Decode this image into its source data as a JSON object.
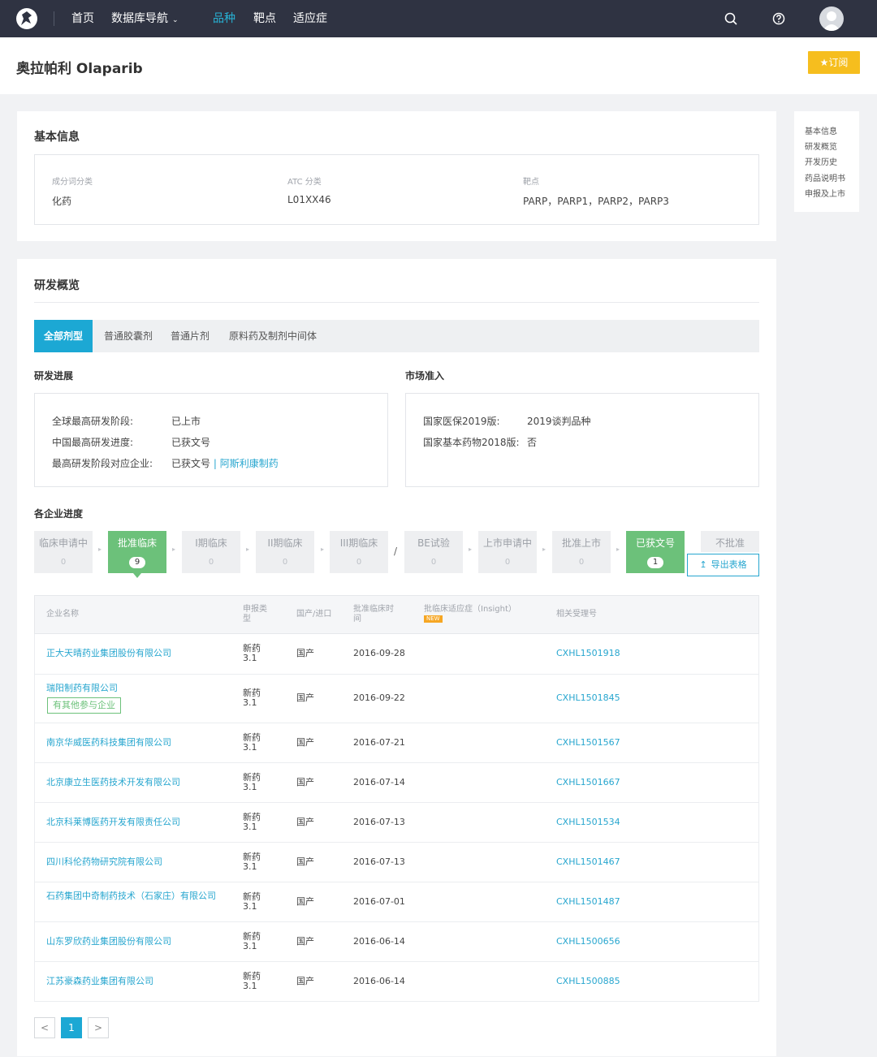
{
  "nav": {
    "home": "首页",
    "db_nav": "数据库导航",
    "variety": "品种",
    "target": "靶点",
    "indication": "适应症"
  },
  "page": {
    "title": "奥拉帕利 Olaparib",
    "subscribe": "订阅"
  },
  "basic": {
    "heading": "基本信息",
    "fields": [
      {
        "label": "成分词分类",
        "value": "化药"
      },
      {
        "label": "ATC 分类",
        "value": "L01XX46"
      },
      {
        "label": "靶点",
        "value": "PARP，PARP1，PARP2，PARP3"
      }
    ]
  },
  "rd": {
    "heading": "研发概览",
    "tabs": [
      "全部剂型",
      "普通胶囊剂",
      "普通片剂",
      "原料药及制剂中间体"
    ],
    "progress": {
      "heading": "研发进展",
      "rows": [
        {
          "k": "全球最高研发阶段:",
          "v": "已上市"
        },
        {
          "k": "中国最高研发进度:",
          "v": "已获文号"
        },
        {
          "k": "最高研发阶段对应企业:",
          "v": "已获文号",
          "sep": " | ",
          "link": "阿斯利康制药"
        }
      ]
    },
    "market": {
      "heading": "市场准入",
      "rows": [
        {
          "k": "国家医保2019版:",
          "v": "2019谈判品种"
        },
        {
          "k": "国家基本药物2018版:",
          "v": "否"
        }
      ]
    }
  },
  "enterprise": {
    "heading": "各企业进度",
    "stages": [
      {
        "name": "临床申请中",
        "count": "0"
      },
      {
        "name": "批准临床",
        "count": "9"
      },
      {
        "name": "I期临床",
        "count": "0"
      },
      {
        "name": "II期临床",
        "count": "0"
      },
      {
        "name": "III期临床",
        "count": "0"
      },
      {
        "name": "BE试验",
        "count": "0"
      },
      {
        "name": "上市申请中",
        "count": "0"
      },
      {
        "name": "批准上市",
        "count": "0"
      },
      {
        "name": "已获文号",
        "count": "1"
      },
      {
        "name": "不批准"
      }
    ],
    "slash": "/",
    "export": "导出表格",
    "columns": [
      "企业名称",
      "申报类型",
      "国产/进口",
      "批准临床时间",
      "批临床适应症（Insight）",
      "相关受理号"
    ],
    "new_badge": "NEW",
    "rows": [
      {
        "company": "正大天晴药业集团股份有限公司",
        "type": "新药 3.1",
        "origin": "国产",
        "date": "2016-09-28",
        "no": "CXHL1501918"
      },
      {
        "company": "瑞阳制药有限公司",
        "tag": "有其他参与企业",
        "type": "新药 3.1",
        "origin": "国产",
        "date": "2016-09-22",
        "no": "CXHL1501845"
      },
      {
        "company": "南京华威医药科技集团有限公司",
        "type": "新药 3.1",
        "origin": "国产",
        "date": "2016-07-21",
        "no": "CXHL1501567"
      },
      {
        "company": "北京康立生医药技术开发有限公司",
        "type": "新药 3.1",
        "origin": "国产",
        "date": "2016-07-14",
        "no": "CXHL1501667"
      },
      {
        "company": "北京科莱博医药开发有限责任公司",
        "type": "新药 3.1",
        "origin": "国产",
        "date": "2016-07-13",
        "no": "CXHL1501534"
      },
      {
        "company": "四川科伦药物研究院有限公司",
        "type": "新药 3.1",
        "origin": "国产",
        "date": "2016-07-13",
        "no": "CXHL1501467"
      },
      {
        "company": "石药集团中奇制药技术（石家庄）有限公司",
        "type": "新药 3.1",
        "origin": "国产",
        "date": "2016-07-01",
        "no": "CXHL1501487"
      },
      {
        "company": "山东罗欣药业集团股份有限公司",
        "type": "新药 3.1",
        "origin": "国产",
        "date": "2016-06-14",
        "no": "CXHL1500656"
      },
      {
        "company": "江苏豪森药业集团有限公司",
        "type": "新药 3.1",
        "origin": "国产",
        "date": "2016-06-14",
        "no": "CXHL1500885"
      }
    ],
    "pagination": {
      "prev": "<",
      "current": "1",
      "next": ">"
    }
  },
  "sidebar": {
    "items": [
      "基本信息",
      "研发概览",
      "开发历史",
      "药品说明书",
      "申报及上市"
    ]
  }
}
